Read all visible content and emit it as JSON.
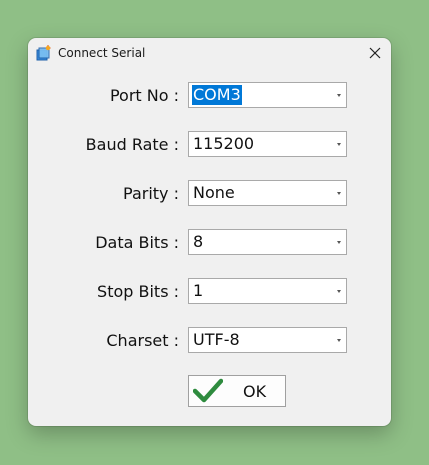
{
  "dialog": {
    "title": "Connect Serial",
    "icon": "serial-port-app-icon",
    "close_icon": "close-icon"
  },
  "fields": [
    {
      "label": "Port No :",
      "value": "COM3",
      "selected": true
    },
    {
      "label": "Baud Rate :",
      "value": "115200",
      "selected": false
    },
    {
      "label": "Parity :",
      "value": "None",
      "selected": false
    },
    {
      "label": "Data Bits :",
      "value": "8",
      "selected": false
    },
    {
      "label": "Stop Bits :",
      "value": "1",
      "selected": false
    },
    {
      "label": "Charset :",
      "value": "UTF-8",
      "selected": false
    }
  ],
  "ok_button": {
    "label": "OK",
    "icon": "checkmark-icon",
    "icon_color": "#2e8b3e"
  },
  "colors": {
    "desktop_background": "#8fbf86",
    "dialog_background": "#f0f0f0",
    "selection_highlight": "#0078d7"
  }
}
